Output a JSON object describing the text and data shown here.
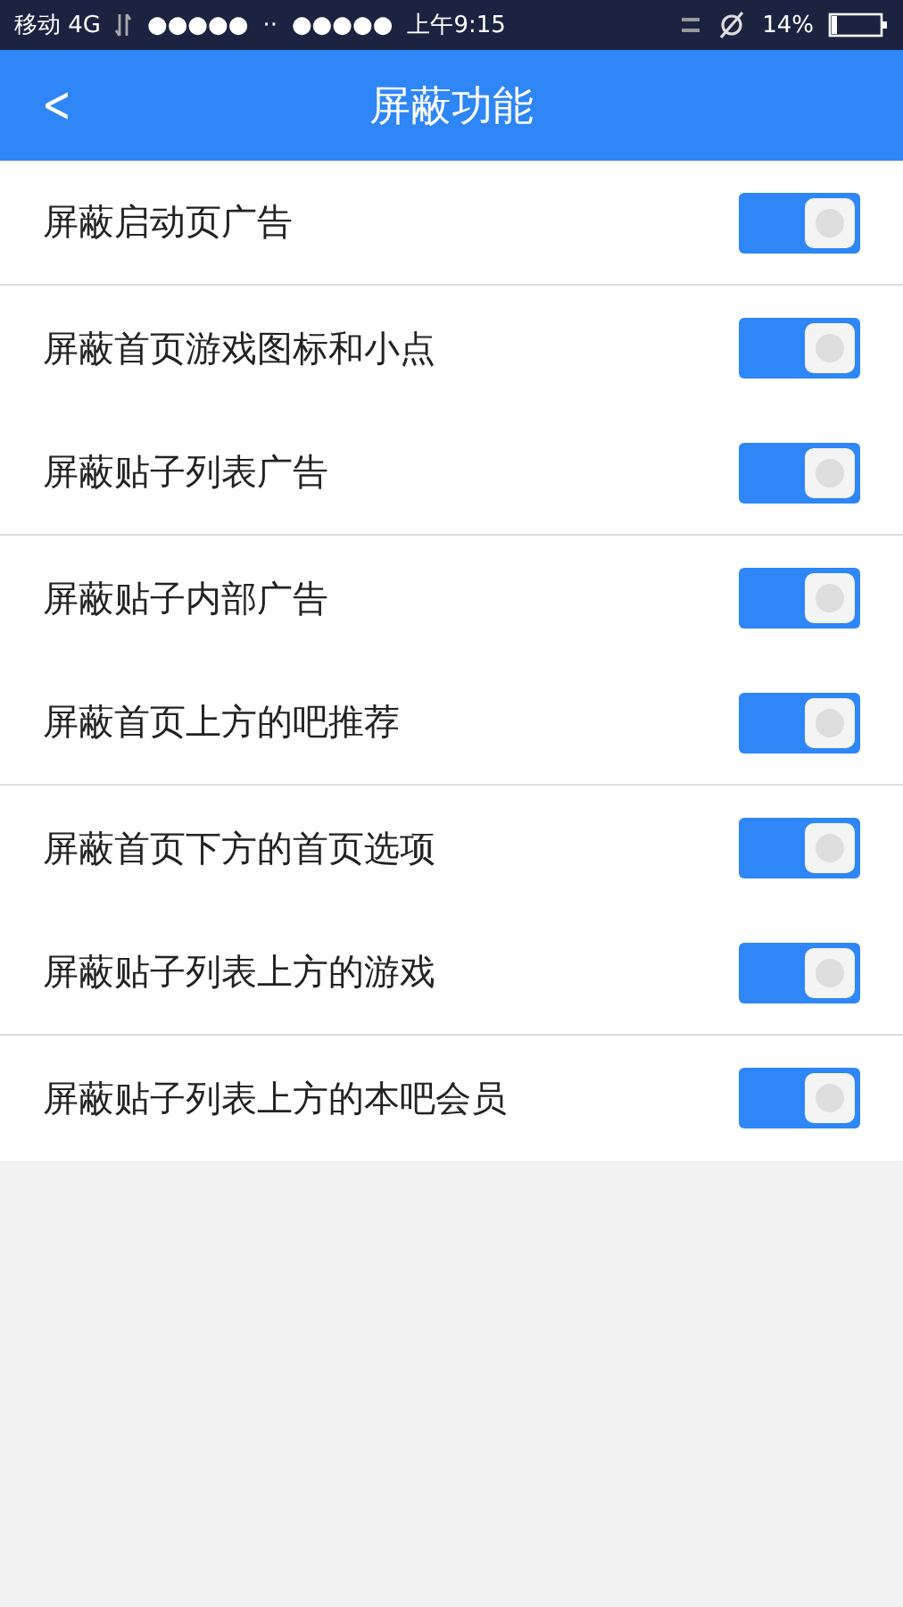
{
  "status_bar": {
    "carrier": "移动 4G",
    "signal_1": "●●●●●",
    "dots": "··",
    "signal_2": "●●●●●",
    "time": "上午9:15",
    "battery": "14%"
  },
  "header": {
    "back": "<",
    "title": "屏蔽功能"
  },
  "settings": [
    {
      "label": "屏蔽启动页广告",
      "on": true
    },
    {
      "label": "屏蔽首页游戏图标和小点",
      "on": true
    },
    {
      "label": "屏蔽贴子列表广告",
      "on": true
    },
    {
      "label": "屏蔽贴子内部广告",
      "on": true
    },
    {
      "label": "屏蔽首页上方的吧推荐",
      "on": true
    },
    {
      "label": "屏蔽首页下方的首页选项",
      "on": true
    },
    {
      "label": "屏蔽贴子列表上方的游戏",
      "on": true
    },
    {
      "label": "屏蔽贴子列表上方的本吧会员",
      "on": true
    }
  ]
}
